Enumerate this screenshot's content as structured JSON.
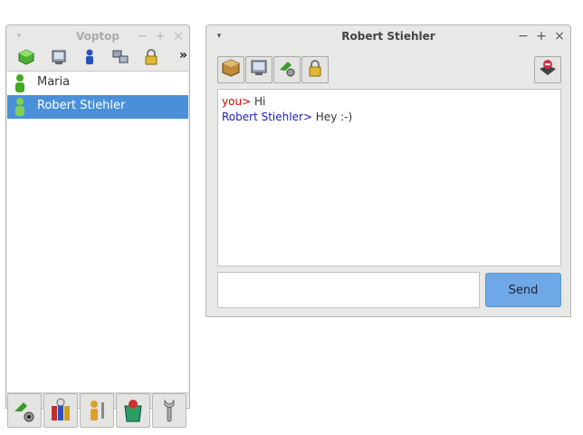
{
  "contact_window": {
    "title": "Voptop",
    "toolbar_icons": [
      "add-contact-icon",
      "computer-icon",
      "person-blue-icon",
      "network-icon",
      "lock-icon"
    ],
    "more_label": "»",
    "contacts": [
      {
        "name": "Maria",
        "status_color": "#3faa1f",
        "selected": false
      },
      {
        "name": "Robert Stiehler",
        "status_color": "#7fd04f",
        "selected": true
      }
    ],
    "bottom_icons": [
      "call-webcam-icon",
      "conference-icon",
      "user-settings-icon",
      "trash-icon",
      "wrench-icon"
    ]
  },
  "chat_window": {
    "title": "Robert Stiehler",
    "toolbar_icons": [
      "file-transfer-icon",
      "computer-icon",
      "phone-icon",
      "lock-icon"
    ],
    "block_icon": "block-user-icon",
    "messages": [
      {
        "sender": "you>",
        "text": "Hi"
      },
      {
        "sender": "Robert Stiehler>",
        "text": "Hey :-)"
      }
    ],
    "input_value": "",
    "send_label": "Send"
  },
  "window_controls": {
    "menu": "▾",
    "minimize": "−",
    "maximize": "+",
    "close": "×"
  },
  "colors": {
    "selection": "#4a90d9",
    "send_button": "#6fa8e6",
    "self_sender": "#dd0000",
    "other_sender": "#2020c0"
  }
}
